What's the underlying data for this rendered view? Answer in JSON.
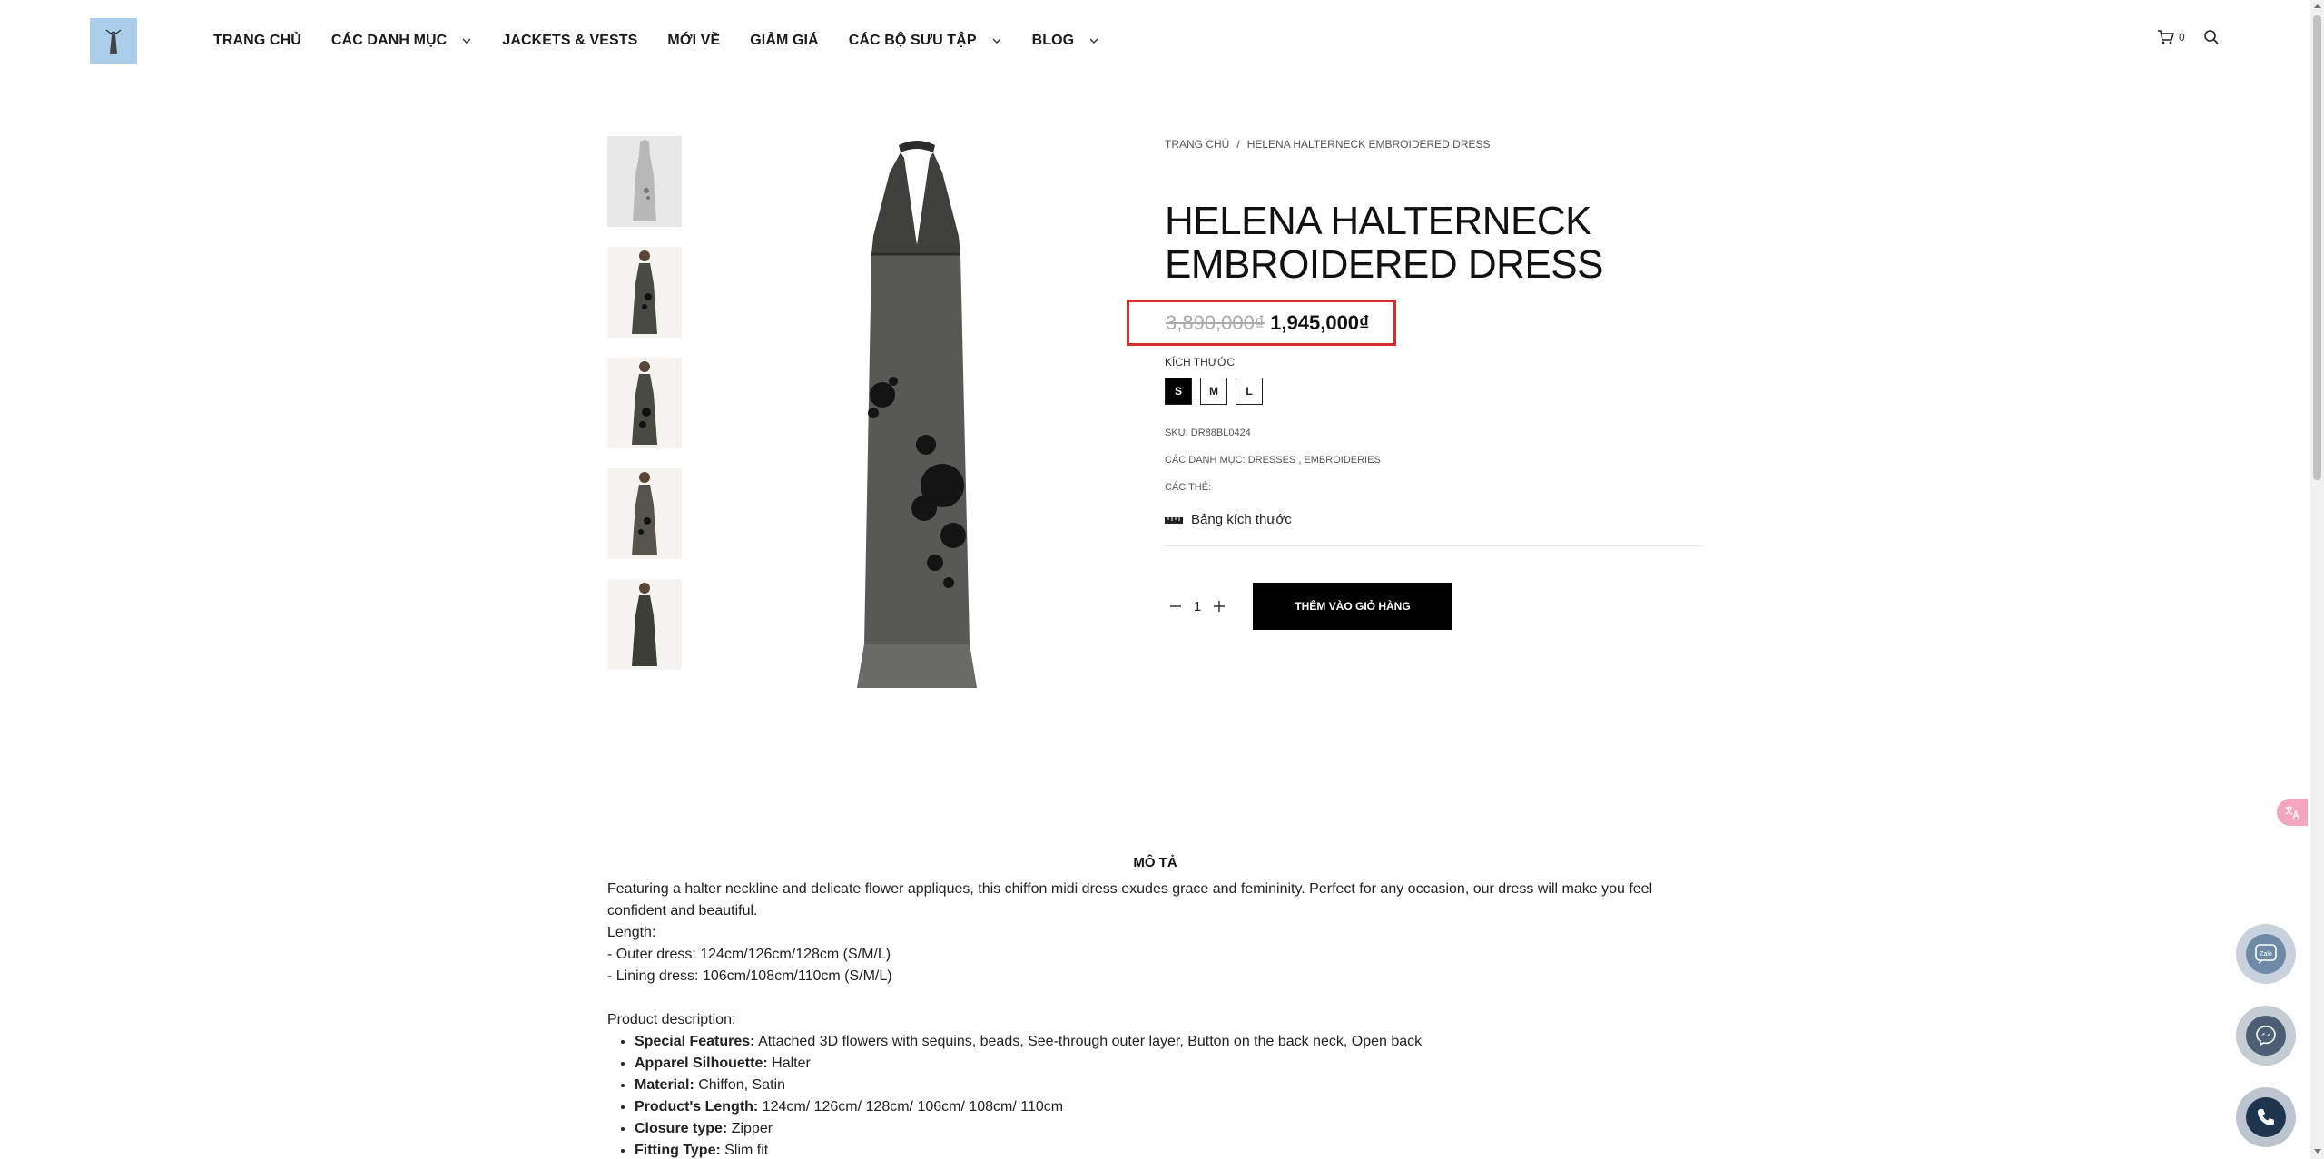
{
  "header": {
    "nav": [
      {
        "label": "TRANG CHỦ",
        "has_dropdown": false
      },
      {
        "label": "CÁC DANH MỤC",
        "has_dropdown": true
      },
      {
        "label": "JACKETS & VESTS",
        "has_dropdown": false
      },
      {
        "label": "MỚI VỀ",
        "has_dropdown": false
      },
      {
        "label": "GIẢM GIÁ",
        "has_dropdown": false
      },
      {
        "label": "CÁC BỘ SƯU TẬP",
        "has_dropdown": true
      },
      {
        "label": "BLOG",
        "has_dropdown": true
      }
    ],
    "cart_count": "0"
  },
  "breadcrumb": {
    "home": "TRANG CHỦ",
    "separator": "/",
    "current": "HELENA HALTERNECK EMBROIDERED DRESS"
  },
  "product": {
    "title": "HELENA HALTERNECK EMBROIDERED DRESS",
    "price_old": "3,890,000₫",
    "price_new": "1,945,000₫",
    "size_label": "KÍCH THƯỚC",
    "sizes": [
      "S",
      "M",
      "L"
    ],
    "selected_size": "S",
    "sku_label": "SKU:",
    "sku": "DR88BL0424",
    "categories_label": "CÁC DANH MỤC:",
    "categories": "DRESSES , EMBROIDERIES",
    "tags_label": "CÁC THẺ:",
    "size_chart_label": "Bảng kích thước",
    "quantity": "1",
    "add_to_cart": "THÊM VÀO GIỎ HÀNG",
    "highlight_color": "#d62d2d"
  },
  "description": {
    "title": "MÔ TẢ",
    "intro": "Featuring a halter neckline and delicate flower appliques, this chiffon midi dress exudes grace and femininity. Perfect for any occasion, our dress will make you feel confident and beautiful.",
    "length_label": "Length:",
    "outer": "- Outer dress: 124cm/126cm/128cm (S/M/L)",
    "lining": "- Lining dress: 106cm/108cm/110cm (S/M/L)",
    "product_desc_label": "Product description:",
    "features": [
      {
        "key": "Special Features:",
        "value": " Attached 3D flowers with sequins, beads, See-through outer layer, Button on the back neck, Open back"
      },
      {
        "key": "Apparel Silhouette:",
        "value": " Halter"
      },
      {
        "key": "Material:",
        "value": " Chiffon, Satin"
      },
      {
        "key": "Product's Length:",
        "value": " 124cm/ 126cm/ 128cm/ 106cm/ 108cm/ 110cm"
      },
      {
        "key": "Closure type:",
        "value": " Zipper"
      },
      {
        "key": "Fitting Type:",
        "value": " Slim fit"
      }
    ]
  },
  "floating": {
    "zalo_label": "Zalo"
  },
  "colors": {
    "logo_bg": "#a9cdea",
    "button_bg": "#000000",
    "zalo": "#6f8aa6",
    "messenger": "#4b5e73",
    "phone": "#1e3550"
  }
}
